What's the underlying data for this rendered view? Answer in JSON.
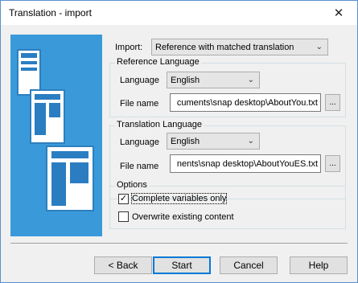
{
  "window": {
    "title": "Translation - import",
    "close_glyph": "✕"
  },
  "import": {
    "label": "Import:",
    "selected": "Reference with matched translation"
  },
  "reference": {
    "group_title": "Reference Language",
    "language_label": "Language",
    "language_value": "English",
    "file_label": "File name",
    "file_value": "cuments\\snap desktop\\AboutYou.txt",
    "browse_label": "..."
  },
  "translation": {
    "group_title": "Translation Language",
    "language_label": "Language",
    "language_value": "English",
    "file_label": "File name",
    "file_value": "nents\\snap desktop\\AboutYouES.txt",
    "browse_label": "..."
  },
  "options": {
    "group_title": "Options",
    "complete_variables_label": "Complete variables only",
    "complete_variables_checked": true,
    "overwrite_label": "Overwrite existing content",
    "overwrite_checked": false,
    "check_glyph": "✓"
  },
  "buttons": {
    "back": "< Back",
    "start": "Start",
    "cancel": "Cancel",
    "help": "Help"
  },
  "icons": {
    "dropdown": "chevron-down-icon",
    "close": "close-icon",
    "chevron_glyph": "⌄"
  },
  "colors": {
    "art_background": "#3a9ad9",
    "doc_bar": "#2b7dc2",
    "focus_border": "#0078d7"
  }
}
